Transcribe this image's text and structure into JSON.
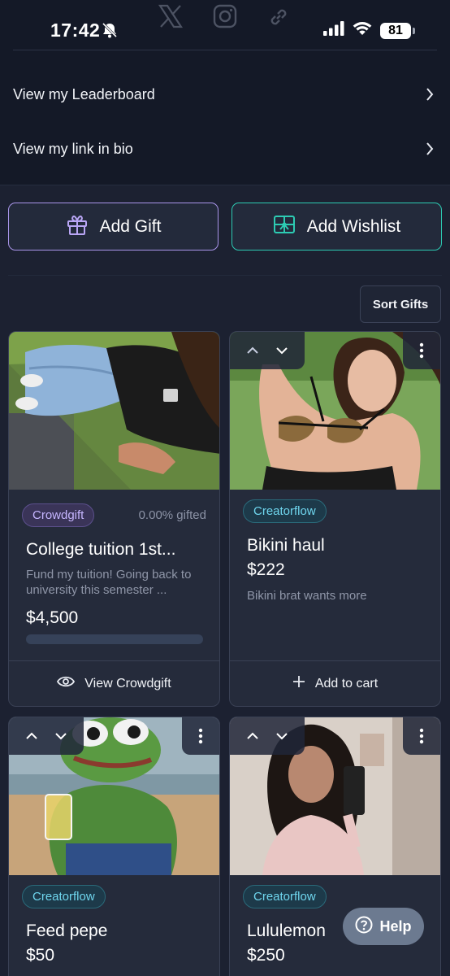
{
  "status_bar": {
    "time": "17:42",
    "battery": "81",
    "icons": [
      "bell-muted-icon",
      "x-logo-icon",
      "instagram-icon",
      "link-icon",
      "signal-icon",
      "wifi-icon",
      "battery-icon"
    ]
  },
  "nav": {
    "items": [
      {
        "label": "View my Leaderboard",
        "icon": "chevron-right-icon"
      },
      {
        "label": "View my link in bio",
        "icon": "chevron-right-icon"
      }
    ]
  },
  "actions": {
    "add_gift_label": "Add Gift",
    "add_wishlist_label": "Add Wishlist",
    "sort_label": "Sort Gifts"
  },
  "colors": {
    "background": "#1c2131",
    "card": "#252b3b",
    "gift_border": "#a995ea",
    "wishlist_border": "#2dcbb3",
    "crowdgift_badge_text": "#c6b6ff",
    "creatorflow_badge_text": "#6fd6ee"
  },
  "cards": [
    {
      "badge": "Crowdgift",
      "gifted": "0.00% gifted",
      "title": "College tuition 1st...",
      "description": "Fund my tuition! Going back to university this semester ...",
      "price": "$4,500",
      "progress": 0.0,
      "footer_label": "View Crowdgift",
      "footer_icon": "eye-icon"
    },
    {
      "badge": "Creatorflow",
      "title": "Bikini haul",
      "price": "$222",
      "description": "Bikini brat wants more",
      "footer_label": "Add to cart",
      "footer_icon": "plus-icon"
    },
    {
      "badge": "Creatorflow",
      "title": "Feed pepe",
      "price": "$50"
    },
    {
      "badge": "Creatorflow",
      "title": "Lululemon",
      "price": "$250"
    }
  ],
  "help": {
    "label": "Help",
    "icon": "question-circle-icon"
  }
}
